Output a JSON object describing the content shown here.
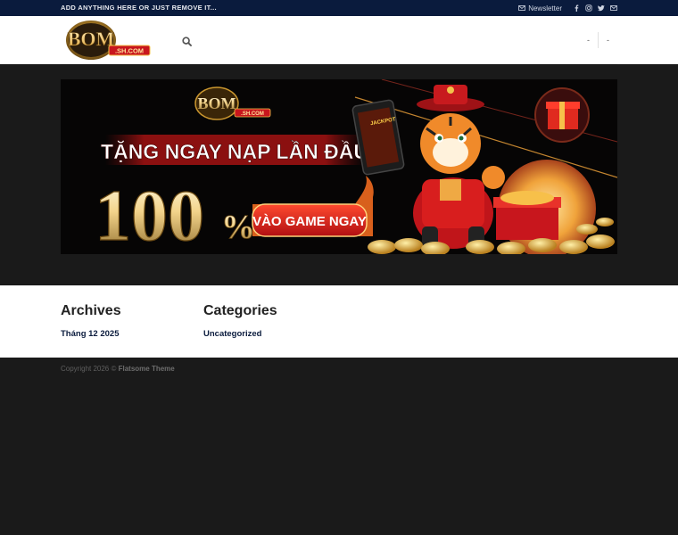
{
  "topbar": {
    "text": "ADD ANYTHING HERE OR JUST REMOVE IT...",
    "newsletter_label": "Newsletter",
    "social_icons": [
      "facebook-icon",
      "instagram-icon",
      "twitter-icon",
      "envelope-icon"
    ]
  },
  "header": {
    "logo_text": "BOM",
    "logo_sub": ".SH.COM",
    "nav_right": [
      "-",
      "-"
    ]
  },
  "banner": {
    "logo_text": "BOM",
    "logo_sub": ".SH.COM",
    "headline": "TẶNG NGAY NẠP LẦN ĐẦU",
    "percent": "100",
    "percent_sign": "%",
    "cta": "VÀO GAME NGAY",
    "phone_label": "JACKPOT"
  },
  "widgets": {
    "archives": {
      "title": "Archives",
      "items": [
        "Tháng 12 2025"
      ]
    },
    "categories": {
      "title": "Categories",
      "items": [
        "Uncategorized"
      ]
    }
  },
  "footer": {
    "copyright": "Copyright 2026 ©",
    "theme": "Flatsome Theme"
  },
  "colors": {
    "topbar_bg": "#0a1b3d",
    "link": "#0a1b3d",
    "footer_bg": "#1a1a1a",
    "banner_red": "#d8261d",
    "banner_gold": "#f3c24b"
  }
}
